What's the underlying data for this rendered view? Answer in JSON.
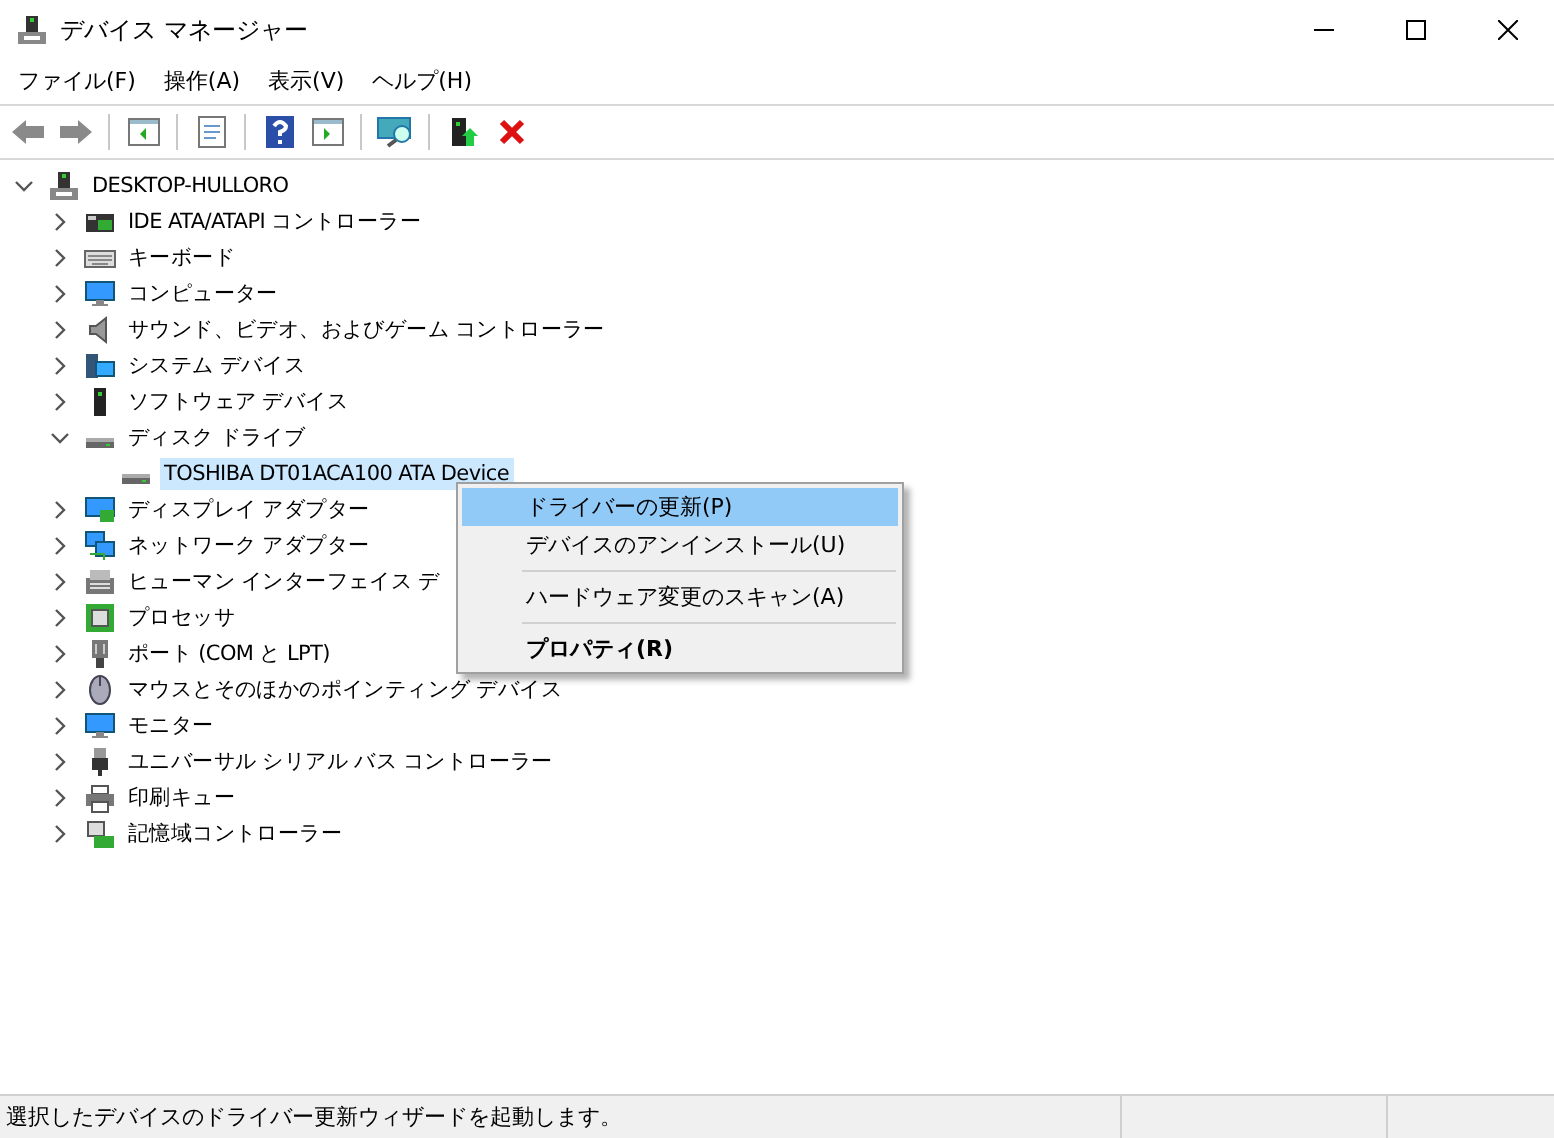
{
  "window": {
    "title": "デバイス マネージャー"
  },
  "menu_bar": [
    "ファイル(F)",
    "操作(A)",
    "表示(V)",
    "ヘルプ(H)"
  ],
  "tree": {
    "label": "DESKTOP-HULLORO",
    "expanded": true,
    "selected": false,
    "children": [
      {
        "label": "IDE ATA/ATAPI コントローラー",
        "expanded": false,
        "selected": false
      },
      {
        "label": "キーボード",
        "expanded": false,
        "selected": false
      },
      {
        "label": "コンピューター",
        "expanded": false,
        "selected": false
      },
      {
        "label": "サウンド、ビデオ、およびゲーム コントローラー",
        "expanded": false,
        "selected": false
      },
      {
        "label": "システム デバイス",
        "expanded": false,
        "selected": false
      },
      {
        "label": "ソフトウェア デバイス",
        "expanded": false,
        "selected": false
      },
      {
        "label": "ディスク ドライブ",
        "expanded": true,
        "selected": false,
        "children": [
          {
            "label": "TOSHIBA DT01ACA100 ATA Device",
            "selected": true
          }
        ]
      },
      {
        "label": "ディスプレイ アダプター",
        "expanded": false,
        "selected": false
      },
      {
        "label": "ネットワーク アダプター",
        "expanded": false,
        "selected": false
      },
      {
        "label": "ヒューマン インターフェイス デ",
        "expanded": false,
        "selected": false
      },
      {
        "label": "プロセッサ",
        "expanded": false,
        "selected": false
      },
      {
        "label": "ポート (COM と LPT)",
        "expanded": false,
        "selected": false
      },
      {
        "label": "マウスとそのほかのポインティング デバイス",
        "expanded": false,
        "selected": false
      },
      {
        "label": "モニター",
        "expanded": false,
        "selected": false
      },
      {
        "label": "ユニバーサル シリアル バス コントローラー",
        "expanded": false,
        "selected": false
      },
      {
        "label": "印刷キュー",
        "expanded": false,
        "selected": false
      },
      {
        "label": "記憶域コントローラー",
        "expanded": false,
        "selected": false
      }
    ]
  },
  "context_menu": [
    {
      "kind": "item",
      "label": "ドライバーの更新(P)",
      "selected": true,
      "default": false
    },
    {
      "kind": "item",
      "label": "デバイスのアンインストール(U)",
      "selected": false,
      "default": false
    },
    {
      "kind": "separator"
    },
    {
      "kind": "item",
      "label": "ハードウェア変更のスキャン(A)",
      "selected": false,
      "default": false
    },
    {
      "kind": "separator"
    },
    {
      "kind": "item",
      "label": "プロパティ(R)",
      "selected": false,
      "default": true
    }
  ],
  "status_bar": {
    "text": "選択したデバイスのドライバー更新ウィザードを起動します。"
  }
}
